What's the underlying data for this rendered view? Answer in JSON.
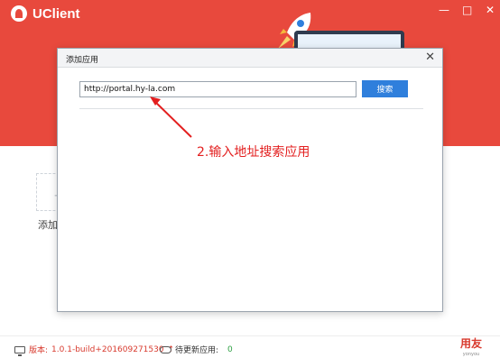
{
  "app": {
    "name": "UClient",
    "window_controls": {
      "minimize": "—",
      "maximize": "□",
      "close": "✕"
    },
    "add_tile": {
      "plus": "+",
      "label": "添加"
    }
  },
  "modal": {
    "title": "添加应用",
    "close_symbol": "✕",
    "url_input": {
      "value": "http://portal.hy-la.com",
      "placeholder": ""
    },
    "search_button": "搜索"
  },
  "annotation": {
    "text": "2.输入地址搜索应用",
    "color": "#e31f1f"
  },
  "status": {
    "version_label": "版本:",
    "version_value": "1.0.1-build+201609271530",
    "version_arrow": "↑",
    "pending_label": "待更新应用:",
    "pending_count": "0",
    "brand_name": "用友",
    "brand_sub": "yonyou"
  },
  "colors": {
    "header": "#e8493d",
    "button": "#2f7fdc",
    "annotation": "#e31f1f"
  }
}
